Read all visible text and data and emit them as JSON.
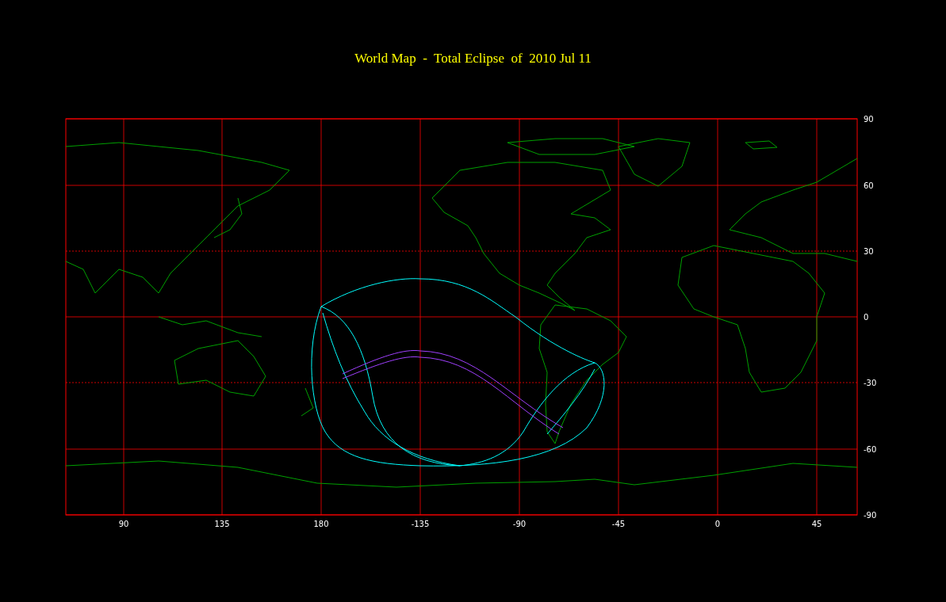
{
  "title": "World Map  -  Total Eclipse  of  2010 Jul 11",
  "map": {
    "x_labels": [
      "90",
      "135",
      "180",
      "-135",
      "-90",
      "-45",
      "0",
      "45"
    ],
    "y_labels": [
      "90",
      "60",
      "30",
      "0",
      "-30",
      "-60",
      "-90"
    ]
  }
}
